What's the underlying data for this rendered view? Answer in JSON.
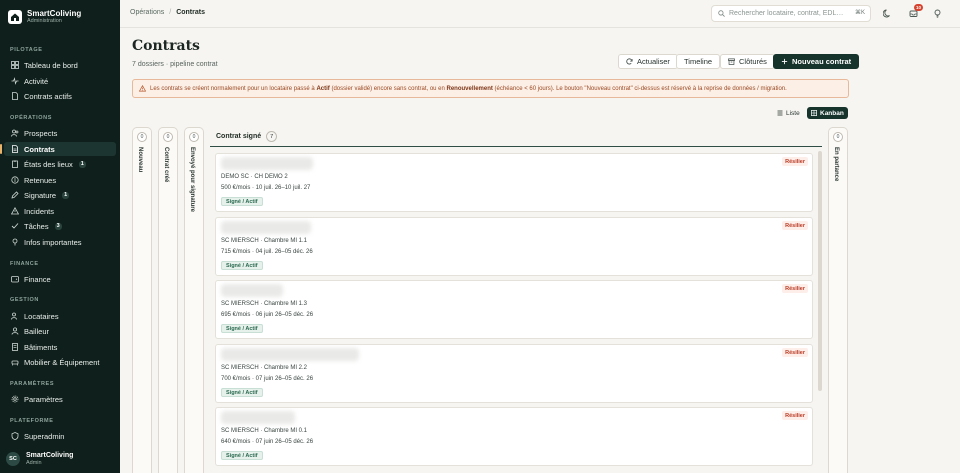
{
  "brand": {
    "name": "SmartColiving",
    "subtitle": "Administration"
  },
  "sidebar": {
    "sections": [
      {
        "label": "PILOTAGE"
      },
      {
        "label": "OPÉRATIONS"
      },
      {
        "label": "FINANCE"
      },
      {
        "label": "GESTION"
      },
      {
        "label": "PARAMÈTRES"
      },
      {
        "label": "PLATEFORME"
      }
    ],
    "items": [
      {
        "label": "Tableau de bord",
        "icon": "dashboard-icon"
      },
      {
        "label": "Activité",
        "icon": "activity-icon"
      },
      {
        "label": "Contrats actifs",
        "icon": "document-icon"
      },
      {
        "label": "Prospects",
        "icon": "users-icon"
      },
      {
        "label": "Contrats",
        "icon": "document-icon"
      },
      {
        "label": "États des lieux",
        "icon": "clipboard-icon",
        "badge": "1"
      },
      {
        "label": "Retenues",
        "icon": "coin-icon"
      },
      {
        "label": "Signature",
        "icon": "pen-icon",
        "badge": "1"
      },
      {
        "label": "Incidents",
        "icon": "alert-icon"
      },
      {
        "label": "Tâches",
        "icon": "check-icon",
        "badge": "3"
      },
      {
        "label": "Infos importantes",
        "icon": "pin-icon"
      },
      {
        "label": "Finance",
        "icon": "wallet-icon"
      },
      {
        "label": "Locataires",
        "icon": "users-icon"
      },
      {
        "label": "Bailleur",
        "icon": "user-icon"
      },
      {
        "label": "Bâtiments",
        "icon": "building-icon"
      },
      {
        "label": "Mobilier & Équipement",
        "icon": "sofa-icon"
      },
      {
        "label": "Paramètres",
        "icon": "gear-icon"
      },
      {
        "label": "Superadmin",
        "icon": "shield-icon"
      }
    ],
    "active_item": "Contrats",
    "user": {
      "initials": "SC",
      "name": "SmartColiving",
      "role": "Admin"
    }
  },
  "topbar": {
    "breadcrumb": [
      "Opérations",
      "Contrats"
    ],
    "search_placeholder": "Rechercher locataire, contrat, EDL…",
    "search_shortcut": "⌘K",
    "notification_count": "10"
  },
  "header": {
    "title": "Contrats",
    "subtitle": "7 dossiers · pipeline contrat",
    "buttons": {
      "refresh": "Actualiser",
      "timeline": "Timeline",
      "closed": "Clôturés",
      "new": "Nouveau contrat"
    }
  },
  "warning": {
    "part1": "Les contrats se créent normalement pour un locataire passé à ",
    "b1": "Actif",
    "part2": " (dossier validé) encore sans contrat, ou en ",
    "b2": "Renouvellement",
    "part3": " (échéance < 60 jours). Le bouton \"Nouveau contrat\" ci-dessus est réservé à la reprise de données / migration."
  },
  "view": {
    "list_label": "Liste",
    "kanban_label": "Kanban"
  },
  "kanban": {
    "collapsed_left": [
      {
        "label": "Nouveau",
        "count": "0"
      },
      {
        "label": "Contrat créé",
        "count": "0"
      },
      {
        "label": "Envoyé pour signature",
        "count": "0"
      }
    ],
    "open_column": {
      "label": "Contrat signé",
      "count": "7"
    },
    "collapsed_right": {
      "label": "En partance",
      "count": "0"
    },
    "cards": [
      {
        "place": "DEMO SC · CH DEMO 2",
        "details": "500 €/mois · 10 juil. 26–10 juil. 27",
        "status": "Signé / Actif",
        "action": "Résilier"
      },
      {
        "place": "SC MIERSCH · Chambre MI 1.1",
        "details": "715 €/mois · 04 juil. 26–05 déc. 26",
        "status": "Signé / Actif",
        "action": "Résilier"
      },
      {
        "place": "SC MIERSCH · Chambre MI 1.3",
        "details": "695 €/mois · 06 juin 26–05 déc. 26",
        "status": "Signé / Actif",
        "action": "Résilier"
      },
      {
        "place": "SC MIERSCH · Chambre MI 2.2",
        "details": "700 €/mois · 07 juin 26–05 déc. 26",
        "status": "Signé / Actif",
        "action": "Résilier"
      },
      {
        "place": "SC MIERSCH · Chambre MI 0.1",
        "details": "640 €/mois · 07 juin 26–05 déc. 26",
        "status": "Signé / Actif",
        "action": "Résilier"
      }
    ]
  },
  "colors": {
    "sidebar_bg": "#0f1f1b",
    "primary": "#16342c",
    "warning_bg": "#fbefe6",
    "danger": "#b93a23",
    "success": "#2b6b51"
  }
}
